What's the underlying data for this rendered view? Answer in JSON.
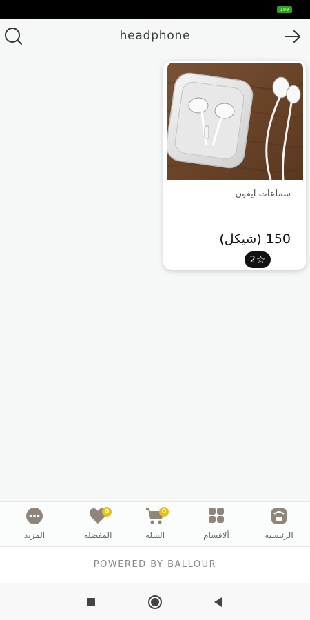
{
  "status_bar": {
    "battery": "100"
  },
  "header": {
    "title": "headphone"
  },
  "product": {
    "name": "سماعات ايفون",
    "price": "150 (شيكل)",
    "rating": "2"
  },
  "bottom_nav": {
    "items": [
      {
        "label": "الرئيسيه",
        "icon": "store-icon"
      },
      {
        "label": "ألاقسام",
        "icon": "grid-icon"
      },
      {
        "label": "السله",
        "icon": "cart-icon",
        "badge": "0"
      },
      {
        "label": "المفضله",
        "icon": "heart-icon",
        "badge": "0"
      },
      {
        "label": "المزيد",
        "icon": "more-icon"
      }
    ]
  },
  "footer": {
    "powered_by": "POWERED BY BALLOUR"
  },
  "colors": {
    "icon_gray": "#8f857b",
    "badge_yellow": "#e5c21a",
    "card_bg": "#ffffff",
    "page_bg": "#f6f8f7"
  }
}
